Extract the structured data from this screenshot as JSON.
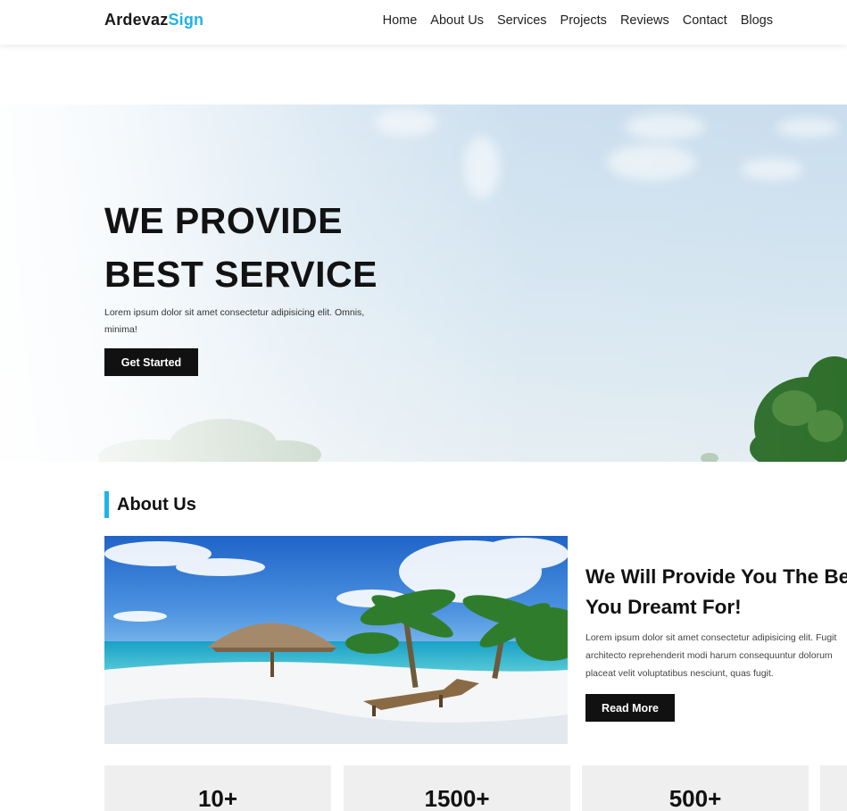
{
  "brand": {
    "part1": "Ardevaz",
    "part2": "Sign",
    "accent_color": "#1db4ea"
  },
  "nav": {
    "items": [
      {
        "label": "Home"
      },
      {
        "label": "About Us"
      },
      {
        "label": "Services"
      },
      {
        "label": "Projects"
      },
      {
        "label": "Reviews"
      },
      {
        "label": "Contact"
      },
      {
        "label": "Blogs"
      }
    ]
  },
  "hero": {
    "title_line1": "WE PROVIDE",
    "title_line2": "BEST SERVICE",
    "text": "Lorem ipsum dolor sit amet consectetur adipisicing elit. Omnis, minima!",
    "button_label": "Get Started"
  },
  "about": {
    "heading": "About Us",
    "title_line1": "We Will Provide You The Best",
    "title_line2": "You Dreamt For!",
    "text_line1": "Lorem ipsum dolor sit amet consectetur adipisicing elit. Fugit",
    "text_line2": "architecto reprehenderit modi harum consequuntur dolorum",
    "text_line3": "placeat velit voluptatibus nesciunt, quas fugit.",
    "button_label": "Read More"
  },
  "stats": [
    {
      "value": "10+"
    },
    {
      "value": "1500+"
    },
    {
      "value": "500+"
    }
  ]
}
